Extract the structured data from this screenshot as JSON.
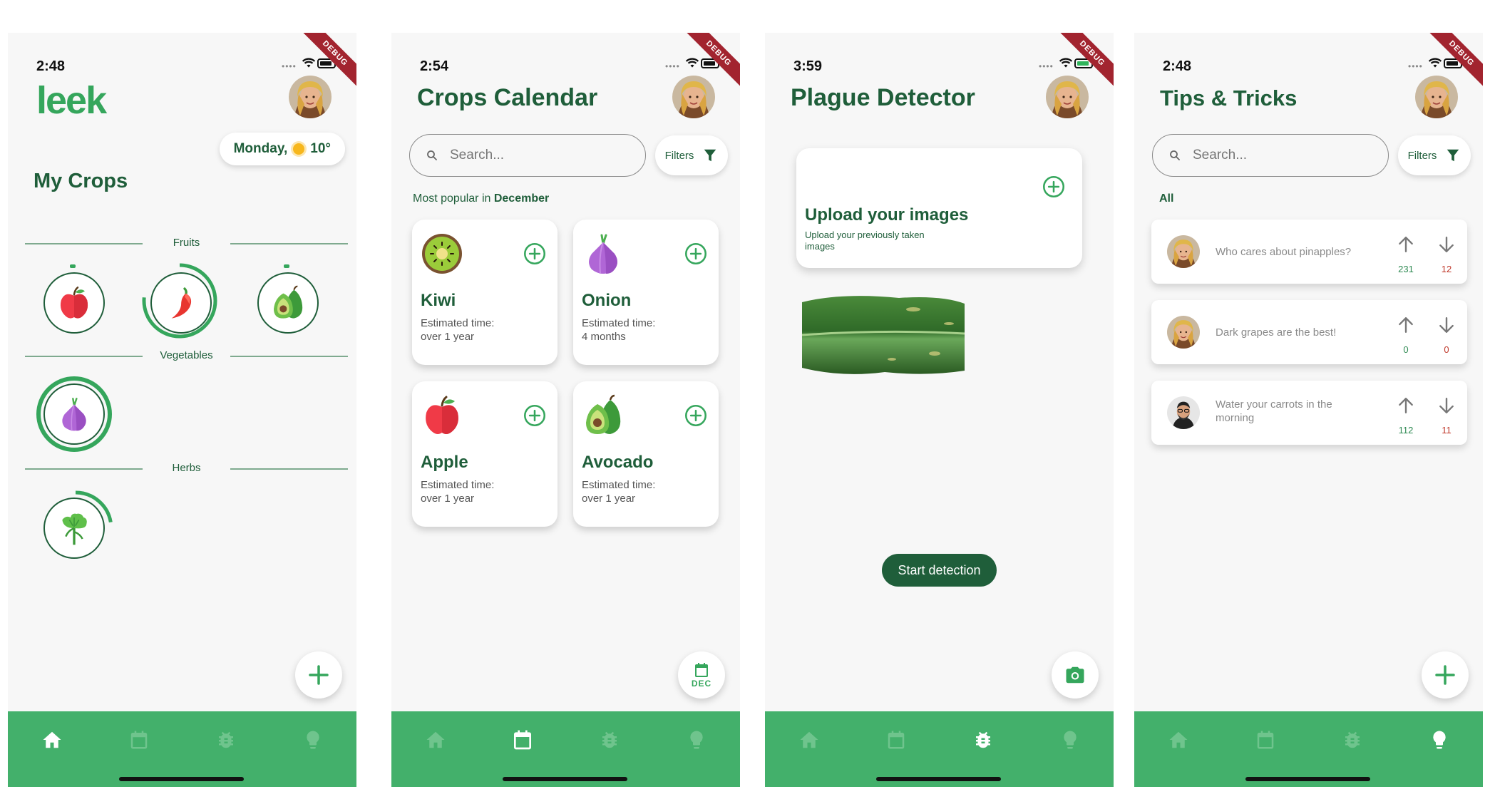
{
  "colors": {
    "brand_green": "#43b06b",
    "dark_green": "#1f5e3a",
    "debug_red": "#a2242f"
  },
  "screens": {
    "home": {
      "time": "2:48",
      "logo": "leek",
      "weather": {
        "day": "Monday,",
        "temp": "10°"
      },
      "section_title": "My Crops",
      "groups": [
        "Fruits",
        "Vegetables",
        "Herbs"
      ],
      "debug": "DEBUG"
    },
    "calendar": {
      "time": "2:54",
      "title": "Crops Calendar",
      "search_placeholder": "Search...",
      "filters": "Filters",
      "popular_prefix": "Most popular in",
      "popular_month": "December",
      "fab_label": "DEC",
      "debug": "DEBUG",
      "cards": [
        {
          "name": "Kiwi",
          "est_label": "Estimated time:",
          "est_value": "over 1 year",
          "icon": "kiwi-icon"
        },
        {
          "name": "Onion",
          "est_label": "Estimated time:",
          "est_value": "4 months",
          "icon": "onion-icon"
        },
        {
          "name": "Apple",
          "est_label": "Estimated time:",
          "est_value": "over 1 year",
          "icon": "apple-icon"
        },
        {
          "name": "Avocado",
          "est_label": "Estimated time:",
          "est_value": "over 1 year",
          "icon": "avocado-icon"
        }
      ]
    },
    "plague": {
      "time": "3:59",
      "title": "Plague Detector",
      "upload_title": "Upload your images",
      "upload_sub": "Upload your previously taken images",
      "start_button": "Start detection",
      "debug": "DEBUG"
    },
    "tips": {
      "time": "2:48",
      "title": "Tips & Tricks",
      "search_placeholder": "Search...",
      "filters": "Filters",
      "filter_all": "All",
      "debug": "DEBUG",
      "posts": [
        {
          "text": "Who cares about pinapples?",
          "up": "231",
          "down": "12"
        },
        {
          "text": "Dark grapes are the best!",
          "up": "0",
          "down": "0"
        },
        {
          "text": "Water your carrots in the morning",
          "up": "112",
          "down": "11"
        }
      ]
    }
  }
}
